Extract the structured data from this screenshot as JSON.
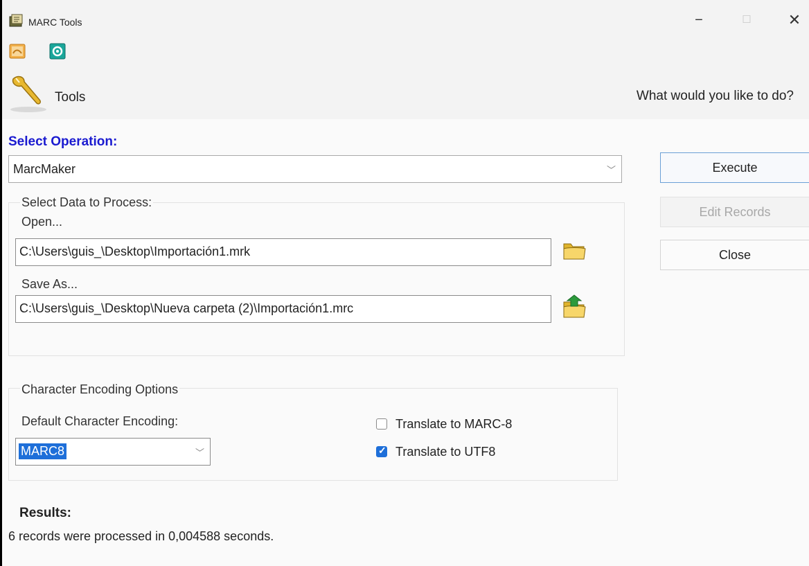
{
  "window": {
    "title": "MARC Tools",
    "minimize_glyph": "−",
    "maximize_glyph": "☐",
    "close_glyph": "✕"
  },
  "header": {
    "label": "Tools",
    "question": "What would you like to do?"
  },
  "operation": {
    "label": "Select Operation:",
    "selected": "MarcMaker",
    "label_color": "#1a1ad0"
  },
  "buttons": {
    "execute": "Execute",
    "edit_records": "Edit Records",
    "close": "Close"
  },
  "data_group": {
    "title": "Select Data to Process:",
    "open_label": "Open...",
    "open_value": "C:\\Users\\guis_\\Desktop\\Importación1.mrk",
    "save_label": "Save As...",
    "save_value": "C:\\Users\\guis_\\Desktop\\Nueva carpeta (2)\\Importación1.mrc"
  },
  "encoding": {
    "title": "Character Encoding Options",
    "default_label": "Default Character Encoding:",
    "selected": "MARC8",
    "options": [
      {
        "label": "Translate to MARC-8",
        "checked": false
      },
      {
        "label": "Translate to UTF8",
        "checked": true
      }
    ],
    "accent_color": "#1e6fd9"
  },
  "results": {
    "label": "Results:",
    "text": "6 records were processed in 0,004588 seconds."
  },
  "icons": {
    "app": "marc-tools-icon",
    "quick1": "marc-editor-icon",
    "quick2": "settings-icon",
    "tools": "wrench-icon",
    "open": "folder-icon",
    "save": "save-folder-icon",
    "dropdown": "chevron-down-icon"
  }
}
